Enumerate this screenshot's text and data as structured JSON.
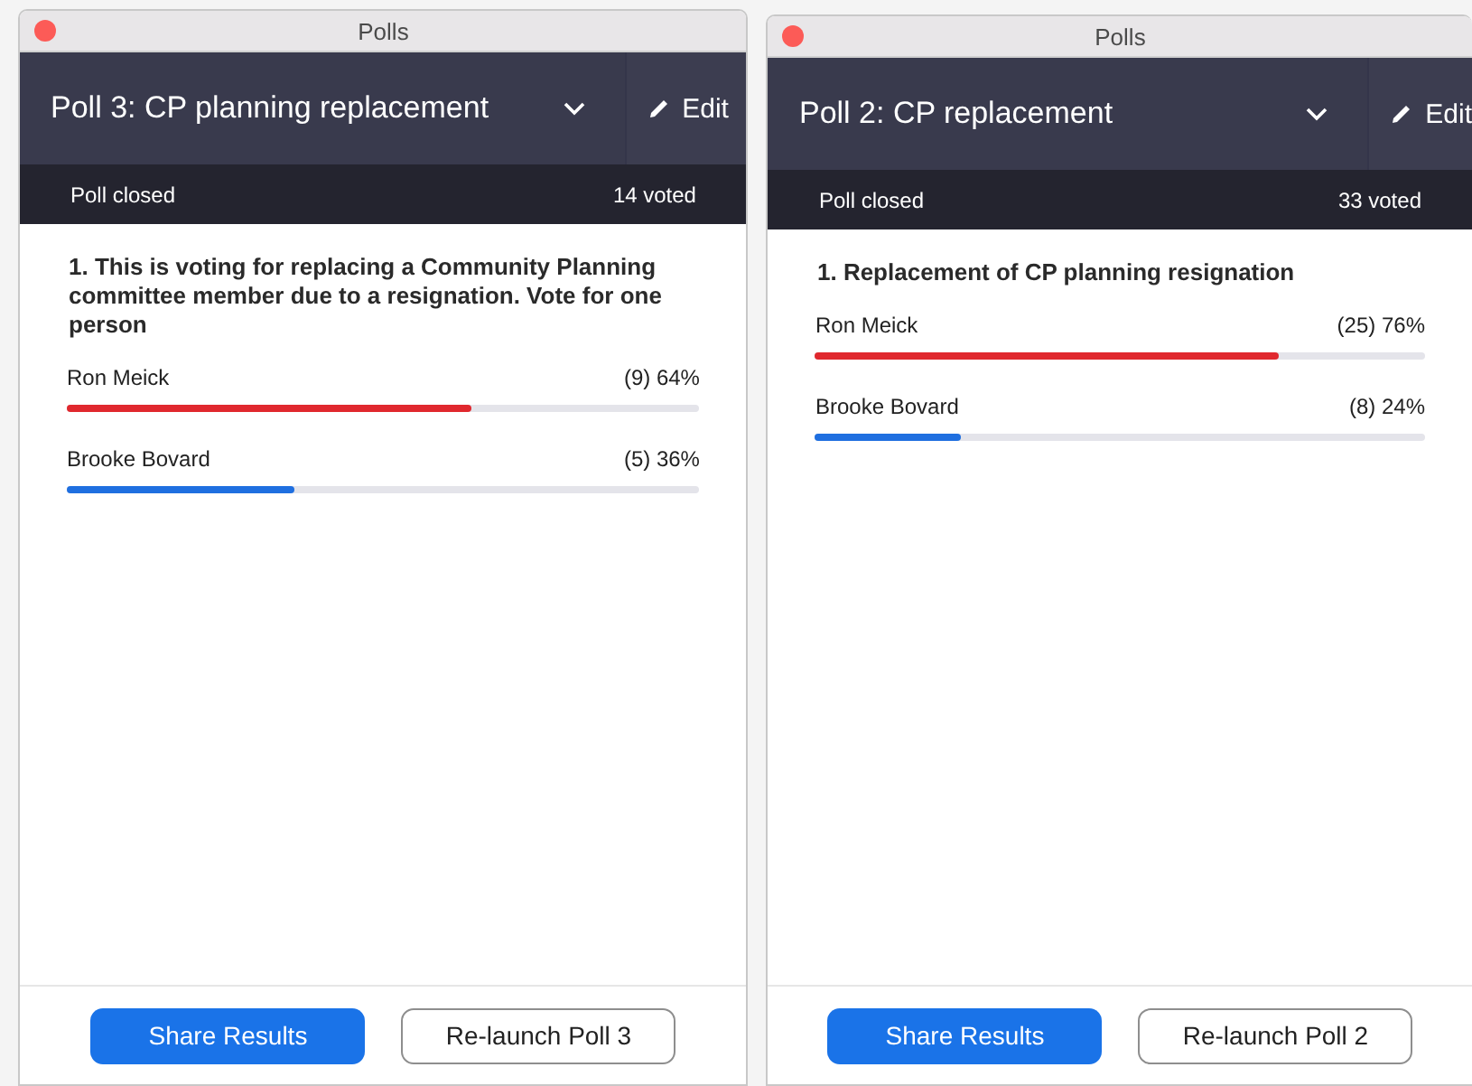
{
  "windows": [
    {
      "title": "Polls",
      "poll_title": "Poll 3: CP planning replacement",
      "edit": "Edit",
      "status": "Poll closed",
      "voted": "14 voted",
      "question": "1. This is voting for replacing a Community Planning committee member due to a resignation.  Vote for one person",
      "answers": [
        {
          "name": "Ron Meick",
          "result": "(9) 64%",
          "level": 0.64,
          "color": "#e0282e"
        },
        {
          "name": "Brooke Bovard",
          "result": "(5) 36%",
          "level": 0.36,
          "color": "#1f6fe0"
        }
      ],
      "buttons": [
        "Share Results",
        "Re-launch Poll 3"
      ]
    },
    {
      "title": "Polls",
      "poll_title": "Poll 2: CP replacement",
      "edit": "Edit",
      "status": "Poll closed",
      "voted": "33 voted",
      "question": "1. Replacement of CP planning resignation",
      "answers": [
        {
          "name": "Ron Meick",
          "result": "(25) 76%",
          "level": 0.76,
          "color": "#e0282e"
        },
        {
          "name": "Brooke Bovard",
          "result": "(8) 24%",
          "level": 0.24,
          "color": "#1f6fe0"
        }
      ],
      "buttons": [
        "Share Results",
        "Re-launch Poll 2"
      ]
    }
  ]
}
